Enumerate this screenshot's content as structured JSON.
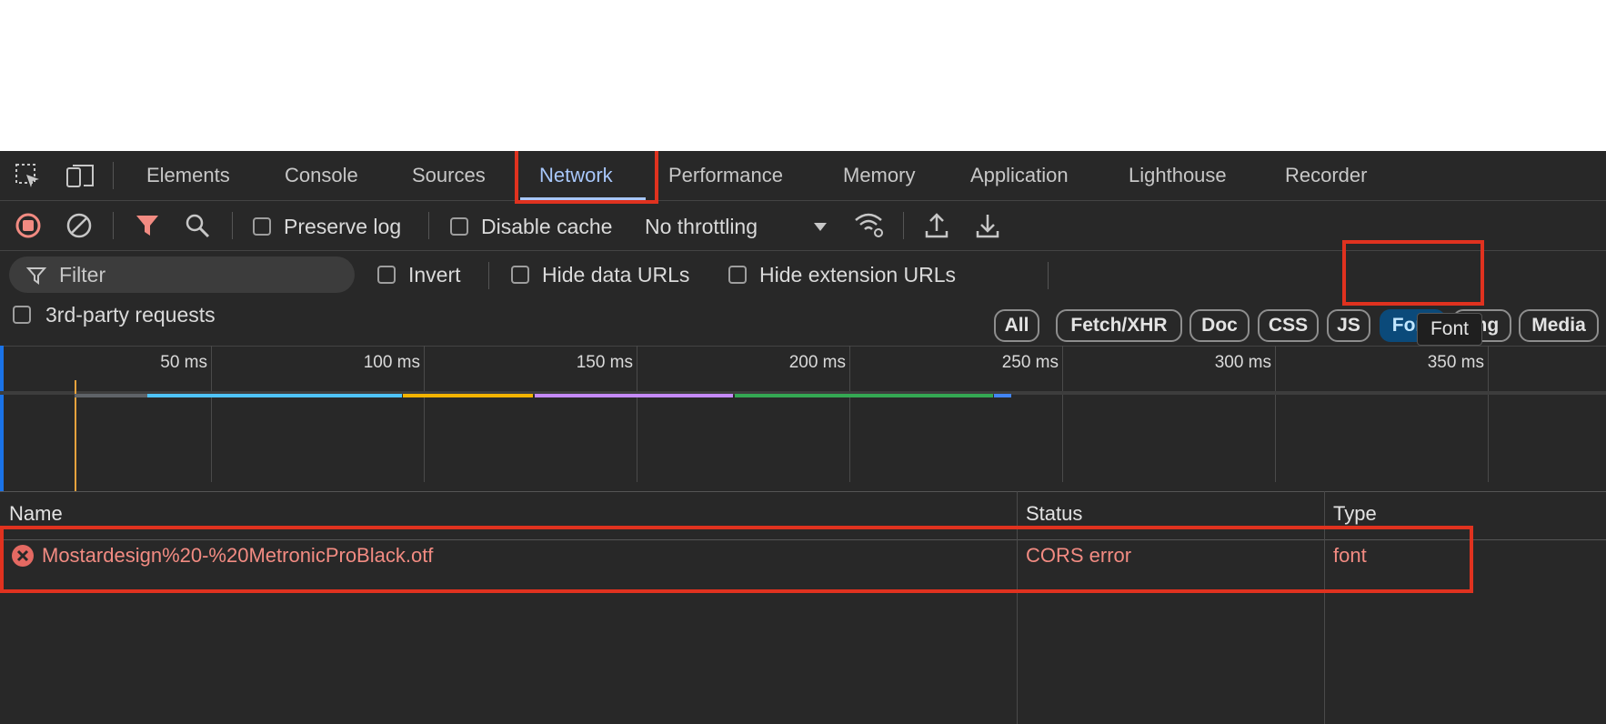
{
  "tabs": [
    {
      "label": "Elements"
    },
    {
      "label": "Console"
    },
    {
      "label": "Sources"
    },
    {
      "label": "Network"
    },
    {
      "label": "Performance"
    },
    {
      "label": "Memory"
    },
    {
      "label": "Application"
    },
    {
      "label": "Lighthouse"
    },
    {
      "label": "Recorder"
    }
  ],
  "toolbar": {
    "preserve_log": "Preserve log",
    "disable_cache": "Disable cache",
    "throttling": "No throttling"
  },
  "filterbar": {
    "filter_placeholder": "Filter",
    "invert": "Invert",
    "hide_data_urls": "Hide data URLs",
    "hide_extension_urls": "Hide extension URLs",
    "types": [
      "All",
      "Fetch/XHR",
      "Doc",
      "CSS",
      "JS",
      "Font",
      "Img",
      "Media"
    ],
    "active_type": "Font",
    "tooltip": "Font"
  },
  "third_party": "3rd-party requests",
  "timeline": {
    "ticks": [
      "50 ms",
      "100 ms",
      "150 ms",
      "200 ms",
      "250 ms",
      "300 ms",
      "350 ms"
    ],
    "segment_colors": [
      "#4fc3f7",
      "#f4b400",
      "#c58af9",
      "#34a853",
      "#4285f4"
    ]
  },
  "table": {
    "columns": {
      "name": "Name",
      "status": "Status",
      "type": "Type"
    },
    "rows": [
      {
        "name": "Mostardesign%20-%20MetronicProBlack.otf",
        "status": "CORS error",
        "type": "font"
      }
    ]
  },
  "colors": {
    "accent": "#a8c7fa",
    "error": "#f28b82",
    "highlight": "#e0321f",
    "active_pill": "#0b4a7a"
  }
}
